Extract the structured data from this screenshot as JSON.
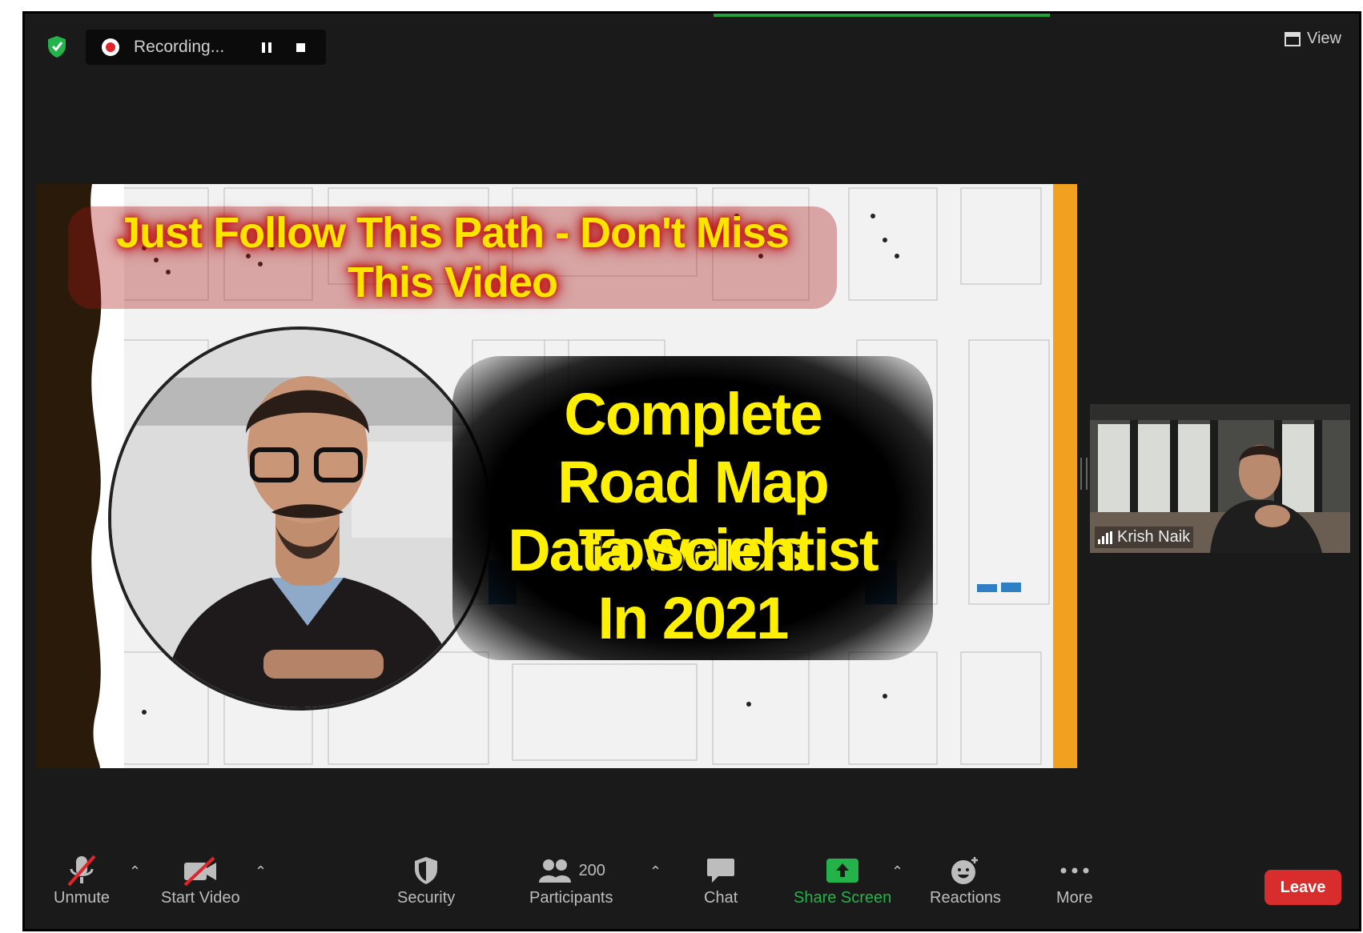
{
  "recording": {
    "label": "Recording..."
  },
  "view": {
    "label": "View"
  },
  "slide": {
    "banner": "Just Follow This Path  - Don't Miss This Video",
    "headline": [
      "Complete",
      "Road Map  Towards",
      "Data Scientist",
      "In 2021"
    ]
  },
  "participant": {
    "name": "Krish Naik"
  },
  "toolbar": {
    "unmute": "Unmute",
    "start_video": "Start Video",
    "security": "Security",
    "participants": "Participants",
    "participants_count": "200",
    "chat": "Chat",
    "share_screen": "Share Screen",
    "reactions": "Reactions",
    "more": "More",
    "leave": "Leave"
  },
  "colors": {
    "share_green": "#24a13a",
    "leave_red": "#d92d2d",
    "headline_yellow": "#ffef00"
  }
}
